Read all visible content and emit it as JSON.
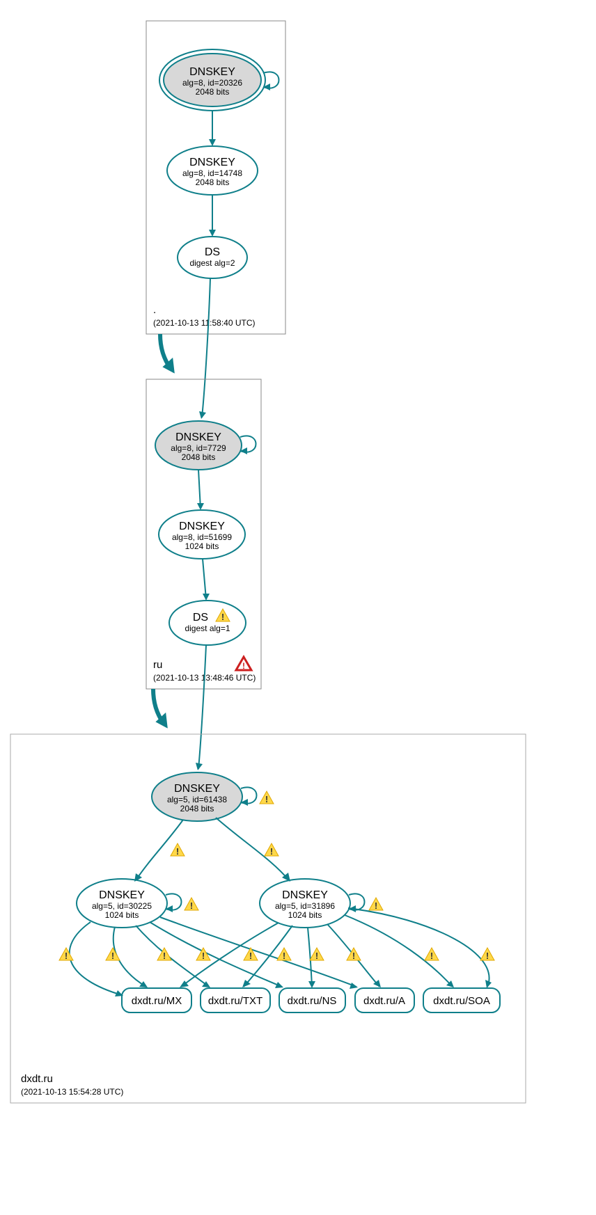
{
  "zones": {
    "root": {
      "label": ".",
      "timestamp": "(2021-10-13 11:58:40 UTC)"
    },
    "tld": {
      "label": "ru",
      "timestamp": "(2021-10-13 13:48:46 UTC)"
    },
    "domain": {
      "label": "dxdt.ru",
      "timestamp": "(2021-10-13 15:54:28 UTC)"
    }
  },
  "nodes": {
    "root_ksk": {
      "title": "DNSKEY",
      "line1": "alg=8, id=20326",
      "line2": "2048 bits"
    },
    "root_zsk": {
      "title": "DNSKEY",
      "line1": "alg=8, id=14748",
      "line2": "2048 bits"
    },
    "root_ds": {
      "title": "DS",
      "line1": "digest alg=2"
    },
    "ru_ksk": {
      "title": "DNSKEY",
      "line1": "alg=8, id=7729",
      "line2": "2048 bits"
    },
    "ru_zsk": {
      "title": "DNSKEY",
      "line1": "alg=8, id=51699",
      "line2": "1024 bits"
    },
    "ru_ds": {
      "title": "DS",
      "line1": "digest alg=1"
    },
    "dxdt_ksk": {
      "title": "DNSKEY",
      "line1": "alg=5, id=61438",
      "line2": "2048 bits"
    },
    "dxdt_zsk1": {
      "title": "DNSKEY",
      "line1": "alg=5, id=30225",
      "line2": "1024 bits"
    },
    "dxdt_zsk2": {
      "title": "DNSKEY",
      "line1": "alg=5, id=31896",
      "line2": "1024 bits"
    }
  },
  "rrsets": {
    "mx": "dxdt.ru/MX",
    "txt": "dxdt.ru/TXT",
    "ns": "dxdt.ru/NS",
    "a": "dxdt.ru/A",
    "soa": "dxdt.ru/SOA"
  }
}
